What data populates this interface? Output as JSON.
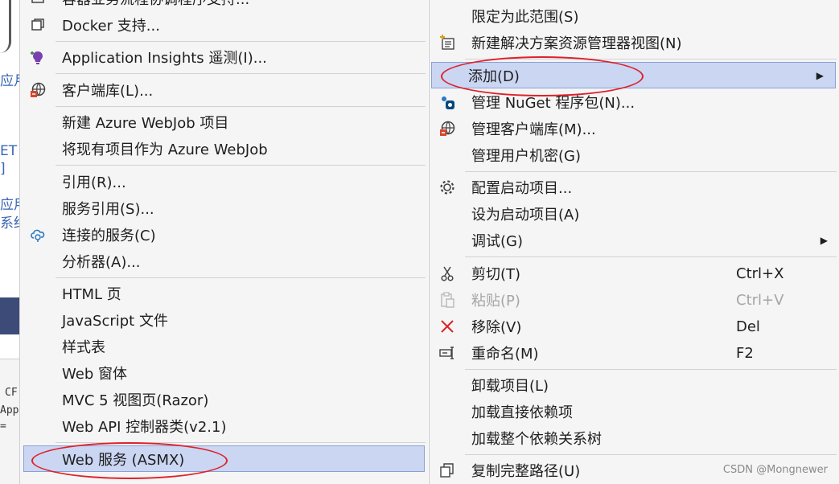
{
  "background": {
    "left_fragments": [
      "应月",
      "ET",
      "]",
      "应用",
      "系结"
    ],
    "code_fragments": [
      "CF",
      "App",
      "="
    ]
  },
  "left_menu": {
    "top_cut_label": "容器业务流程协调程序支持...",
    "items": [
      {
        "label": "Docker 支持...",
        "icon": "docker-support-icon"
      },
      {
        "label": "Application Insights 遥测(I)...",
        "icon": "app-insights-icon"
      },
      {
        "label": "客户端库(L)...",
        "icon": "client-library-icon"
      },
      {
        "label": "新建 Azure WebJob 项目"
      },
      {
        "label": "将现有项目作为 Azure WebJob"
      },
      {
        "label": "引用(R)..."
      },
      {
        "label": "服务引用(S)..."
      },
      {
        "label": "连接的服务(C)",
        "icon": "connected-services-icon"
      },
      {
        "label": "分析器(A)..."
      },
      {
        "label": "HTML 页"
      },
      {
        "label": "JavaScript 文件"
      },
      {
        "label": "样式表"
      },
      {
        "label": "Web 窗体"
      },
      {
        "label": "MVC 5 视图页(Razor)"
      },
      {
        "label": "Web API 控制器类(v2.1)"
      },
      {
        "label": "Web 服务 (ASMX)",
        "highlighted": true
      }
    ]
  },
  "right_menu": {
    "items": [
      {
        "label": "限定为此范围(S)"
      },
      {
        "label": "新建解决方案资源管理器视图(N)",
        "icon": "new-view-icon"
      },
      {
        "label": "添加(D)",
        "highlighted": true,
        "submenu": true
      },
      {
        "label": "管理 NuGet 程序包(N)...",
        "icon": "nuget-icon"
      },
      {
        "label": "管理客户端库(M)...",
        "icon": "client-library-icon"
      },
      {
        "label": "管理用户机密(G)"
      },
      {
        "label": "配置启动项目...",
        "icon": "gear-icon"
      },
      {
        "label": "设为启动项目(A)"
      },
      {
        "label": "调试(G)",
        "submenu": true
      },
      {
        "label": "剪切(T)",
        "shortcut": "Ctrl+X",
        "icon": "cut-icon"
      },
      {
        "label": "粘贴(P)",
        "shortcut": "Ctrl+V",
        "icon": "paste-icon",
        "disabled": true
      },
      {
        "label": "移除(V)",
        "shortcut": "Del",
        "icon": "remove-icon"
      },
      {
        "label": "重命名(M)",
        "shortcut": "F2",
        "icon": "rename-icon"
      },
      {
        "label": "卸载项目(L)"
      },
      {
        "label": "加载直接依赖项"
      },
      {
        "label": "加载整个依赖关系树"
      },
      {
        "label": "复制完整路径(U)",
        "icon": "copy-path-icon"
      }
    ]
  },
  "watermark": "CSDN @Mongnewer",
  "colors": {
    "highlight": "#cad6f2",
    "highlight_border": "#8aa0d6",
    "annotation_oval": "#e0202a",
    "menu_bg": "#f5f5f5"
  }
}
